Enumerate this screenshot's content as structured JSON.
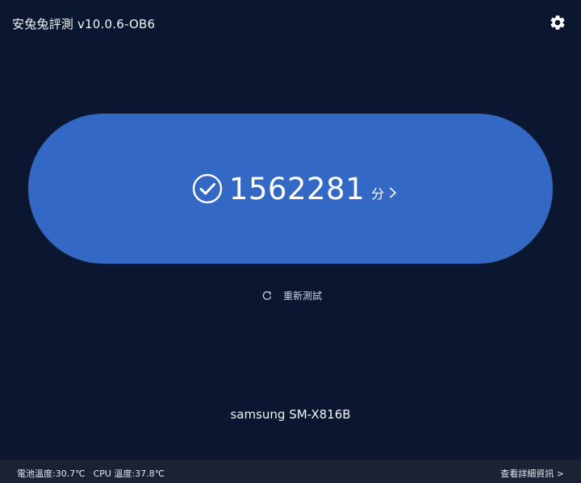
{
  "header": {
    "app_title": "安兔兔評測 v10.0.6-OB6",
    "settings_icon": "gear-icon"
  },
  "score": {
    "value": "1562281",
    "unit": "分",
    "status_icon": "check-circle-icon",
    "chevron_icon": "chevron-right-icon",
    "pill_color": "#3369c4"
  },
  "retest": {
    "icon": "refresh-icon",
    "label": "重新測試"
  },
  "device": {
    "name": "samsung SM-X816B"
  },
  "status_bar": {
    "battery_temp": "電池溫度:30.7℃",
    "cpu_temp": "CPU 溫度:37.8℃",
    "details_link": "查看詳細資訊 >"
  },
  "colors": {
    "background": "#0b1730",
    "status_bar": "#1a2233",
    "accent": "#3369c4"
  }
}
